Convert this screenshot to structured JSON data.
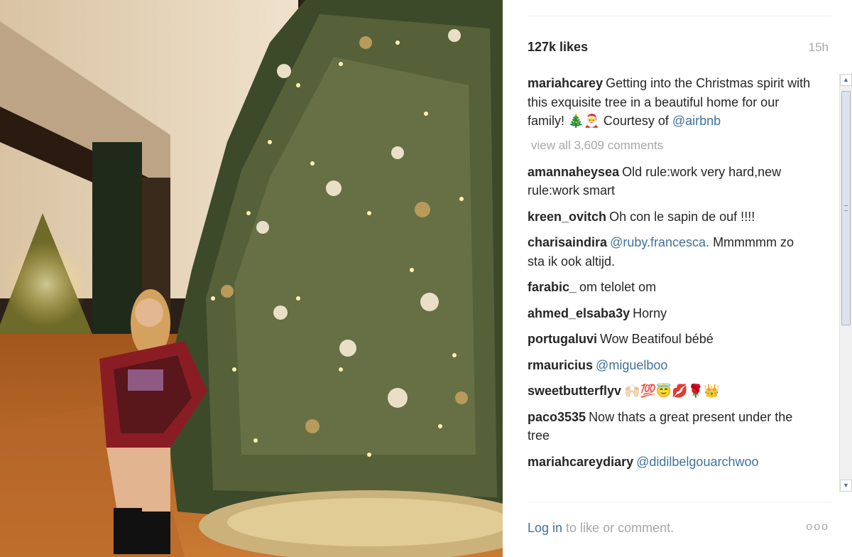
{
  "post": {
    "likes": "127k likes",
    "time": "15h",
    "caption": {
      "user": "mariahcarey",
      "text": "Getting into the Christmas spirit with this exquisite tree in a beautiful home for our family! 🎄🎅 Courtesy of ",
      "mention": "@airbnb"
    },
    "view_all": "view all 3,609 comments"
  },
  "comments": [
    {
      "user": "amannaheysea",
      "text": "Old rule:work very hard,new rule:work smart",
      "mention": ""
    },
    {
      "user": "kreen_ovitch",
      "text": "Oh con le sapin de ouf !!!!",
      "mention": ""
    },
    {
      "user": "charisaindira",
      "text": "",
      "mention": "@ruby.francesca.",
      "after": " Mmmmmm zo sta ik ook altijd."
    },
    {
      "user": "farabic_",
      "text": "om telolet om",
      "mention": ""
    },
    {
      "user": "ahmed_elsaba3y",
      "text": "Horny",
      "mention": ""
    },
    {
      "user": "portugaluvi",
      "text": "Wow Beatifoul bébé",
      "mention": ""
    },
    {
      "user": "rmauricius",
      "text": "",
      "mention": "@miguelboo"
    },
    {
      "user": "sweetbutterflyv",
      "text": "🙌🏻💯😇💋🌹👑",
      "mention": ""
    },
    {
      "user": "paco3535",
      "text": "Now thats a great present under the tree",
      "mention": ""
    },
    {
      "user": "mariahcareydiary",
      "text": "",
      "mention": "@didilbelgouarchwoo"
    }
  ],
  "footer": {
    "login_link": "Log in",
    "login_text": " to like or comment.",
    "more": "ooo"
  },
  "colors": {
    "text": "#262626",
    "muted": "#a5a7aa",
    "link": "#3f729b"
  }
}
